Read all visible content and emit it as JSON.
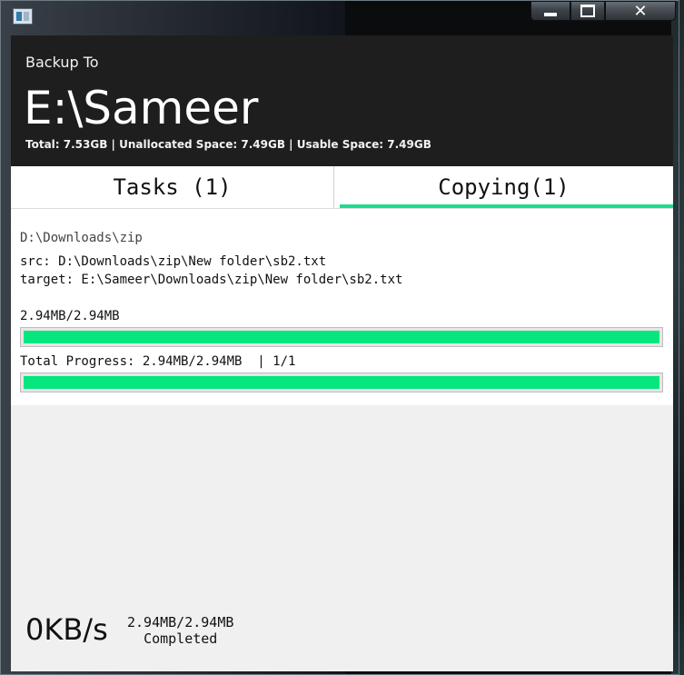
{
  "window": {
    "minimize_label": "",
    "maximize_label": "",
    "close_label": "✕"
  },
  "header": {
    "label": "Backup To",
    "path": "E:\\Sameer",
    "space_info": "Total: 7.53GB | Unallocated Space: 7.49GB | Usable Space: 7.49GB"
  },
  "tabs": [
    {
      "label": "Tasks (1)",
      "selected": false
    },
    {
      "label": "Copying(1)",
      "selected": true
    }
  ],
  "copy": {
    "directory": "D:\\Downloads\\zip",
    "src": "src: D:\\Downloads\\zip\\New folder\\sb2.txt",
    "target": "target: E:\\Sameer\\Downloads\\zip\\New folder\\sb2.txt",
    "file_progress_text": "2.94MB/2.94MB",
    "file_progress": 1.0,
    "total_progress_text": "Total Progress: 2.94MB/2.94MB  | 1/1",
    "total_progress": 1.0
  },
  "footer": {
    "speed": "0KB/s",
    "size": "2.94MB/2.94MB",
    "status": "Completed"
  },
  "colors": {
    "header_bg": "#1e1e1e",
    "accent": "#1edc8c",
    "progress_fill": "#06e67e"
  }
}
